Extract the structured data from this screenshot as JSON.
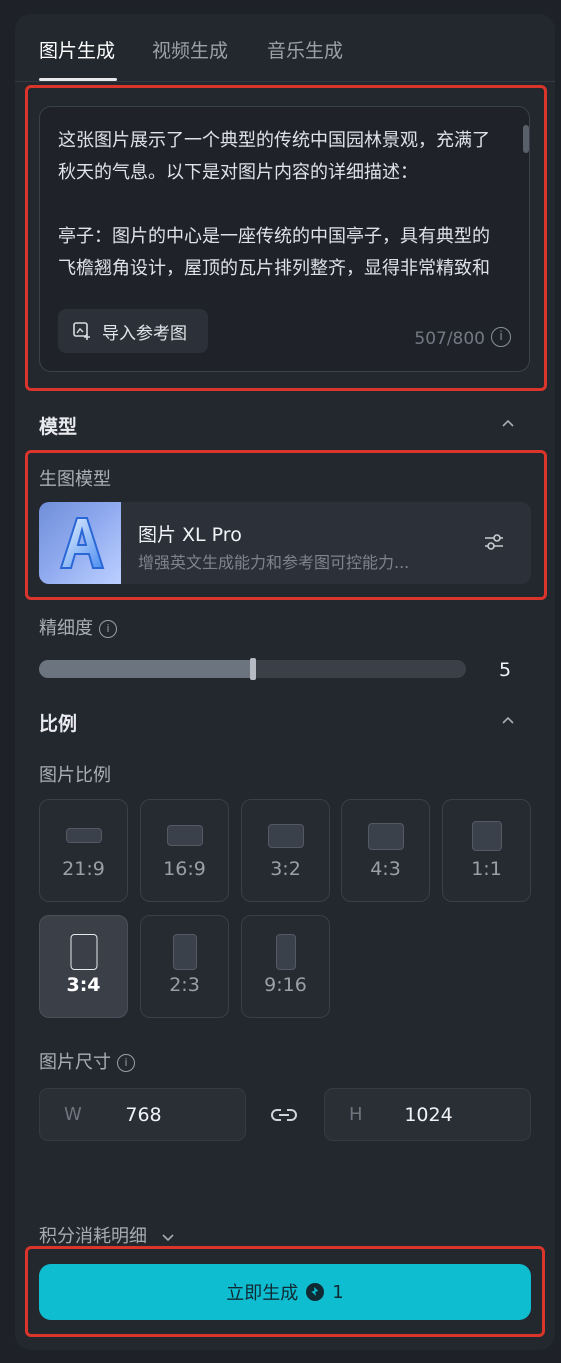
{
  "tabs": [
    {
      "label": "图片生成",
      "active": true
    },
    {
      "label": "视频生成",
      "active": false
    },
    {
      "label": "音乐生成",
      "active": false
    }
  ],
  "prompt": {
    "text": "这张图片展示了一个典型的传统中国园林景观，充满了秋天的气息。以下是对图片内容的详细描述：\n\n亭子：图片的中心是一座传统的中国亭子，具有典型的飞檐翘角设计，屋顶的瓦片排列整齐，显得非常精致和古朴。亭子的木质结构细节丰富，透露出",
    "import_label": "导入参考图",
    "counter": "507/800"
  },
  "model_section": {
    "title": "模型",
    "sub_label": "生图模型",
    "model_name": "图片 XL Pro",
    "model_desc": "增强英文生成能力和参考图可控能力..."
  },
  "precision": {
    "label": "精细度",
    "value": "5",
    "fill_fraction": 0.5
  },
  "ratio_section": {
    "title": "比例",
    "sub_label": "图片比例",
    "ratios": [
      "21:9",
      "16:9",
      "3:2",
      "4:3",
      "1:1",
      "3:4",
      "2:3",
      "9:16"
    ],
    "selected": "3:4"
  },
  "size": {
    "label": "图片尺寸",
    "w_prefix": "W",
    "w_value": "768",
    "h_prefix": "H",
    "h_value": "1024"
  },
  "cost": {
    "label": "积分消耗明细"
  },
  "generate": {
    "label": "立即生成",
    "cost": "1"
  },
  "colors": {
    "accent": "#0fbdd0",
    "highlight_box": "#d9352b"
  }
}
